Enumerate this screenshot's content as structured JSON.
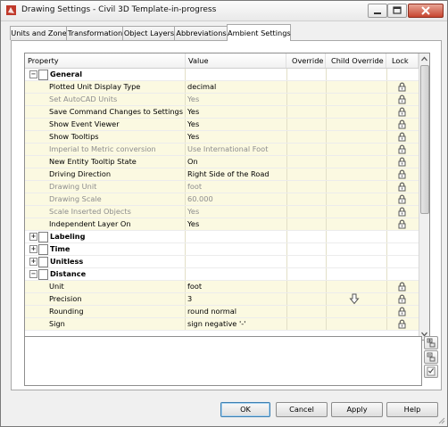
{
  "window": {
    "title": "Drawing Settings - Civil 3D Template-in-progress"
  },
  "tabs": [
    {
      "label": "Units and Zone"
    },
    {
      "label": "Transformation"
    },
    {
      "label": "Object Layers"
    },
    {
      "label": "Abbreviations"
    },
    {
      "label": "Ambient Settings"
    }
  ],
  "active_tab": "Ambient Settings",
  "grid": {
    "columns": [
      "Property",
      "Value",
      "Override",
      "Child Override",
      "Lock"
    ],
    "rows": [
      {
        "type": "category",
        "label": "General",
        "expanded": true
      },
      {
        "type": "prop",
        "label": "Plotted Unit Display Type",
        "value": "decimal",
        "enabled": true
      },
      {
        "type": "prop",
        "label": "Set AutoCAD Units",
        "value": "Yes",
        "enabled": false
      },
      {
        "type": "prop",
        "label": "Save Command Changes to Settings",
        "value": "Yes",
        "enabled": true
      },
      {
        "type": "prop",
        "label": "Show Event Viewer",
        "value": "Yes",
        "enabled": true
      },
      {
        "type": "prop",
        "label": "Show Tooltips",
        "value": "Yes",
        "enabled": true
      },
      {
        "type": "prop",
        "label": "Imperial to Metric conversion",
        "value": "Use International Foot",
        "enabled": false
      },
      {
        "type": "prop",
        "label": "New Entity Tooltip State",
        "value": "On",
        "enabled": true
      },
      {
        "type": "prop",
        "label": "Driving Direction",
        "value": "Right Side of the Road",
        "enabled": true
      },
      {
        "type": "prop",
        "label": "Drawing Unit",
        "value": "foot",
        "enabled": false
      },
      {
        "type": "prop",
        "label": "Drawing Scale",
        "value": "60.000",
        "enabled": false
      },
      {
        "type": "prop",
        "label": "Scale Inserted Objects",
        "value": "Yes",
        "enabled": false
      },
      {
        "type": "prop",
        "label": "Independent Layer On",
        "value": "Yes",
        "enabled": true
      },
      {
        "type": "category",
        "label": "Labeling",
        "expanded": false
      },
      {
        "type": "category",
        "label": "Time",
        "expanded": false
      },
      {
        "type": "category",
        "label": "Unitless",
        "expanded": false
      },
      {
        "type": "category",
        "label": "Distance",
        "expanded": true
      },
      {
        "type": "prop",
        "label": "Unit",
        "value": "foot",
        "enabled": true
      },
      {
        "type": "prop",
        "label": "Precision",
        "value": "3",
        "enabled": true,
        "child_override": "down-arrow-icon"
      },
      {
        "type": "prop",
        "label": "Rounding",
        "value": "round normal",
        "enabled": true
      },
      {
        "type": "prop",
        "label": "Sign",
        "value": "sign negative '-'",
        "enabled": true
      }
    ]
  },
  "buttons": {
    "ok": "OK",
    "cancel": "Cancel",
    "apply": "Apply",
    "help": "Help"
  }
}
